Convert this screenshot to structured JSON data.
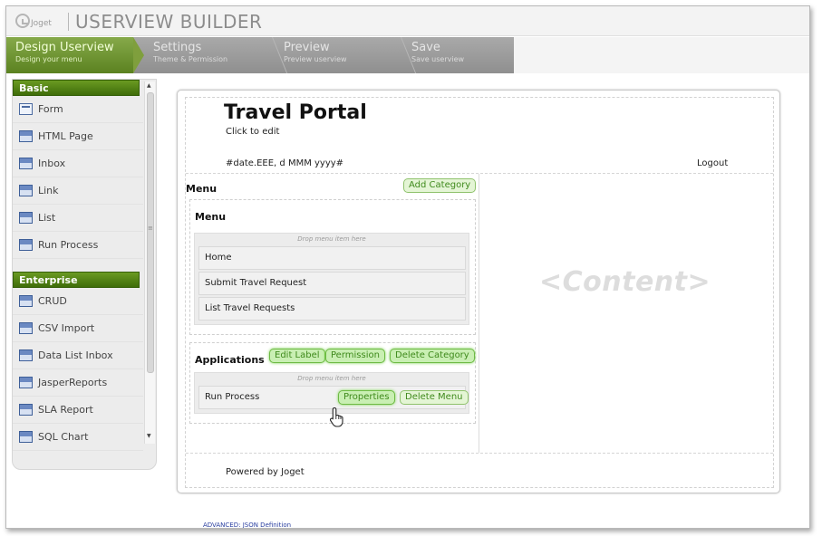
{
  "app": {
    "logo_text": "Joget",
    "title": "USERVIEW BUILDER"
  },
  "steps": [
    {
      "title": "Design Userview",
      "subtitle": "Design your menu"
    },
    {
      "title": "Settings",
      "subtitle": "Theme & Permission"
    },
    {
      "title": "Preview",
      "subtitle": "Preview userview"
    },
    {
      "title": "Save",
      "subtitle": "Save userview"
    }
  ],
  "sidebar": {
    "categories": [
      {
        "name": "Basic",
        "items": [
          "Form",
          "HTML Page",
          "Inbox",
          "Link",
          "List",
          "Run Process"
        ]
      },
      {
        "name": "Enterprise",
        "items": [
          "CRUD",
          "CSV Import",
          "Data List Inbox",
          "JasperReports",
          "SLA Report",
          "SQL Chart"
        ]
      }
    ]
  },
  "canvas": {
    "portal_title": "Travel Portal",
    "click_to_edit": "Click to edit",
    "date_format": "#date.EEE, d MMM yyyy#",
    "logout": "Logout",
    "menu_label": "Menu",
    "add_category": "Add Category",
    "categories": [
      {
        "title": "Menu",
        "drop_hint": "Drop menu item here",
        "items": [
          "Home",
          "Submit Travel Request",
          "List Travel Requests"
        ]
      },
      {
        "title": "Applications",
        "drop_hint": "Drop menu item here",
        "items": [
          "Run Process"
        ],
        "buttons": [
          "Edit Label",
          "Permission",
          "Delete Category"
        ],
        "item_buttons": [
          "Properties",
          "Delete Menu"
        ]
      }
    ],
    "content_placeholder": "<Content>",
    "footer": "Powered by Joget"
  },
  "advanced_link": "ADVANCED: JSON Definition",
  "colors": {
    "accent_green": "#5b8220",
    "button_green": "#3f8a1c",
    "step_gray": "#9a9a9a"
  }
}
